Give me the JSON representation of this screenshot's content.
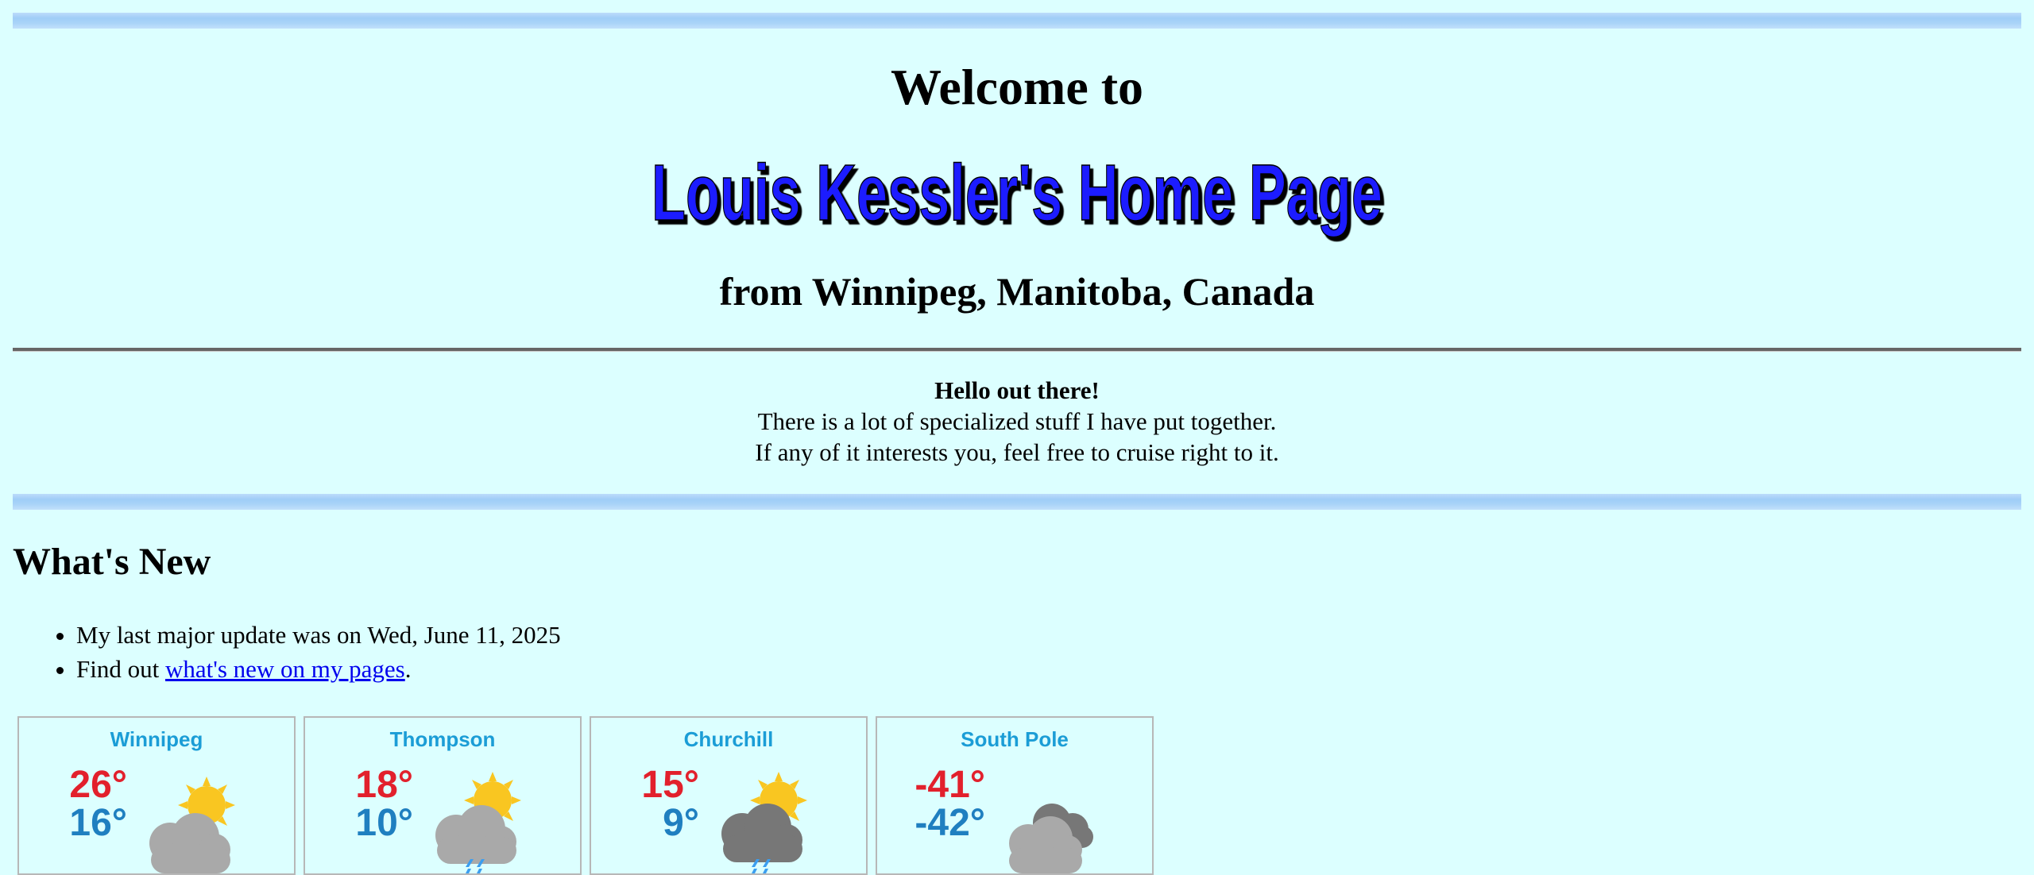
{
  "header": {
    "welcome": "Welcome to",
    "logo_text": "Louis Kessler's Home Page",
    "location": "from Winnipeg, Manitoba, Canada"
  },
  "intro": {
    "greeting": "Hello out there!",
    "line1": "There is a lot of specialized stuff I have put together.",
    "line2": "If any of it interests you, feel free to cruise right to it."
  },
  "whats_new": {
    "title": "What's New",
    "update_text": "My last major update was on Wed, June 11, 2025",
    "find_prefix": "Find out ",
    "find_link": "what's new on my pages",
    "find_suffix": "."
  },
  "weather": [
    {
      "city": "Winnipeg",
      "high": "26°",
      "low": "16°",
      "icon": "partly-sunny-cloud-icon"
    },
    {
      "city": "Thompson",
      "high": "18°",
      "low": "10°",
      "icon": "sun-rain-cloud-icon"
    },
    {
      "city": "Churchill",
      "high": "15°",
      "low": "9°",
      "icon": "dark-cloud-sun-rain-icon"
    },
    {
      "city": "South Pole",
      "high": "-41°",
      "low": "-42°",
      "icon": "cloudy-icon"
    }
  ],
  "colors": {
    "background": "#dcffff",
    "logo_blue": "#1a1aff",
    "link": "#0000ee",
    "high_temp": "#e2202c",
    "low_temp": "#1f7fc0",
    "city": "#1b9dd6"
  }
}
